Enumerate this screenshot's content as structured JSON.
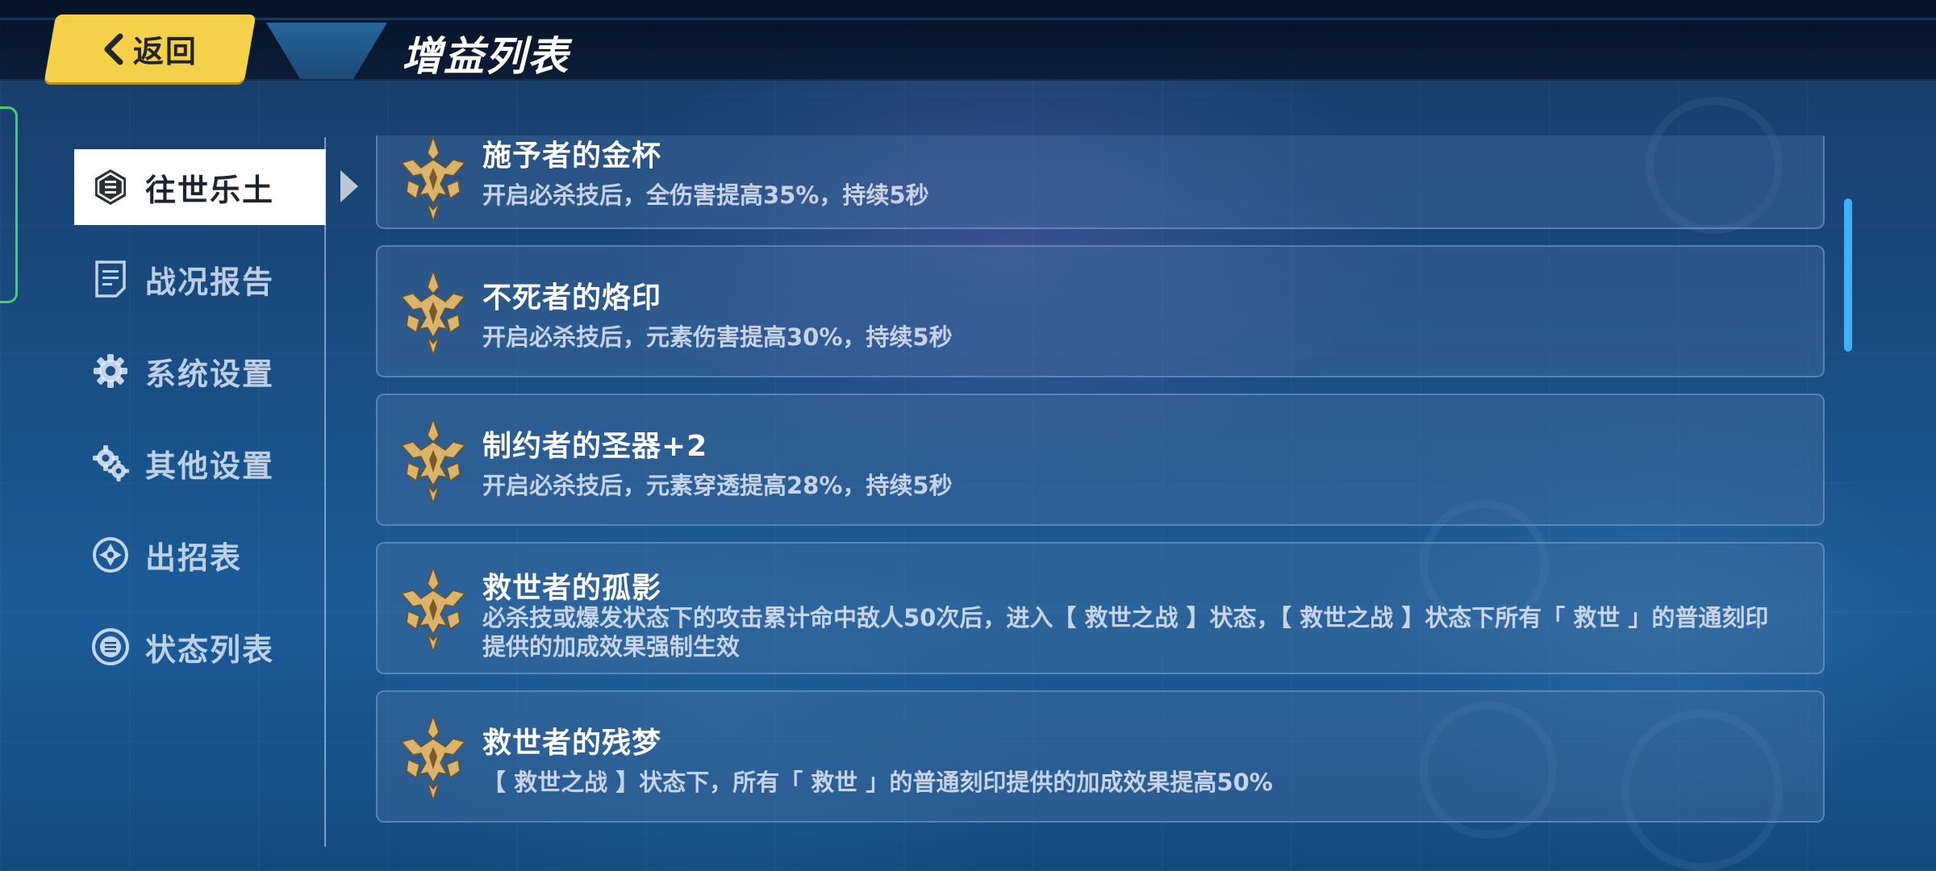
{
  "header": {
    "back_label": "返回",
    "title": "增益列表"
  },
  "sidebar": {
    "items": [
      {
        "label": "往世乐土",
        "icon": "list-badge-icon",
        "active": true
      },
      {
        "label": "战况报告",
        "icon": "report-icon",
        "active": false
      },
      {
        "label": "系统设置",
        "icon": "gear-icon",
        "active": false
      },
      {
        "label": "其他设置",
        "icon": "gears-icon",
        "active": false
      },
      {
        "label": "出招表",
        "icon": "move-list-icon",
        "active": false
      },
      {
        "label": "状态列表",
        "icon": "status-list-icon",
        "active": false
      }
    ]
  },
  "buffs": [
    {
      "name": "施予者的金杯",
      "desc": "开启必杀技后，全伤害提高35%，持续5秒",
      "icon": "golden-emblem-icon"
    },
    {
      "name": "不死者的烙印",
      "desc": "开启必杀技后，元素伤害提高30%，持续5秒",
      "icon": "golden-emblem-icon"
    },
    {
      "name": "制约者的圣器+2",
      "desc": "开启必杀技后，元素穿透提高28%，持续5秒",
      "icon": "golden-emblem-icon"
    },
    {
      "name": "救世者的孤影",
      "desc": "必杀技或爆发状态下的攻击累计命中敌人50次后，进入【 救世之战 】状态，【 救世之战 】状态下所有「 救世 」的普通刻印提供的加成效果强制生效",
      "icon": "golden-emblem-icon"
    },
    {
      "name": "救世者的残梦",
      "desc": "【 救世之战 】状态下，所有「 救世 」的普通刻印提供的加成效果提高50%",
      "icon": "golden-emblem-icon"
    }
  ],
  "colors": {
    "back_button": "#f5d14a",
    "accent_scroll": "#3fb2ff",
    "frame_green": "#4ccb6a",
    "emblem_gold": "#d9b46a"
  }
}
